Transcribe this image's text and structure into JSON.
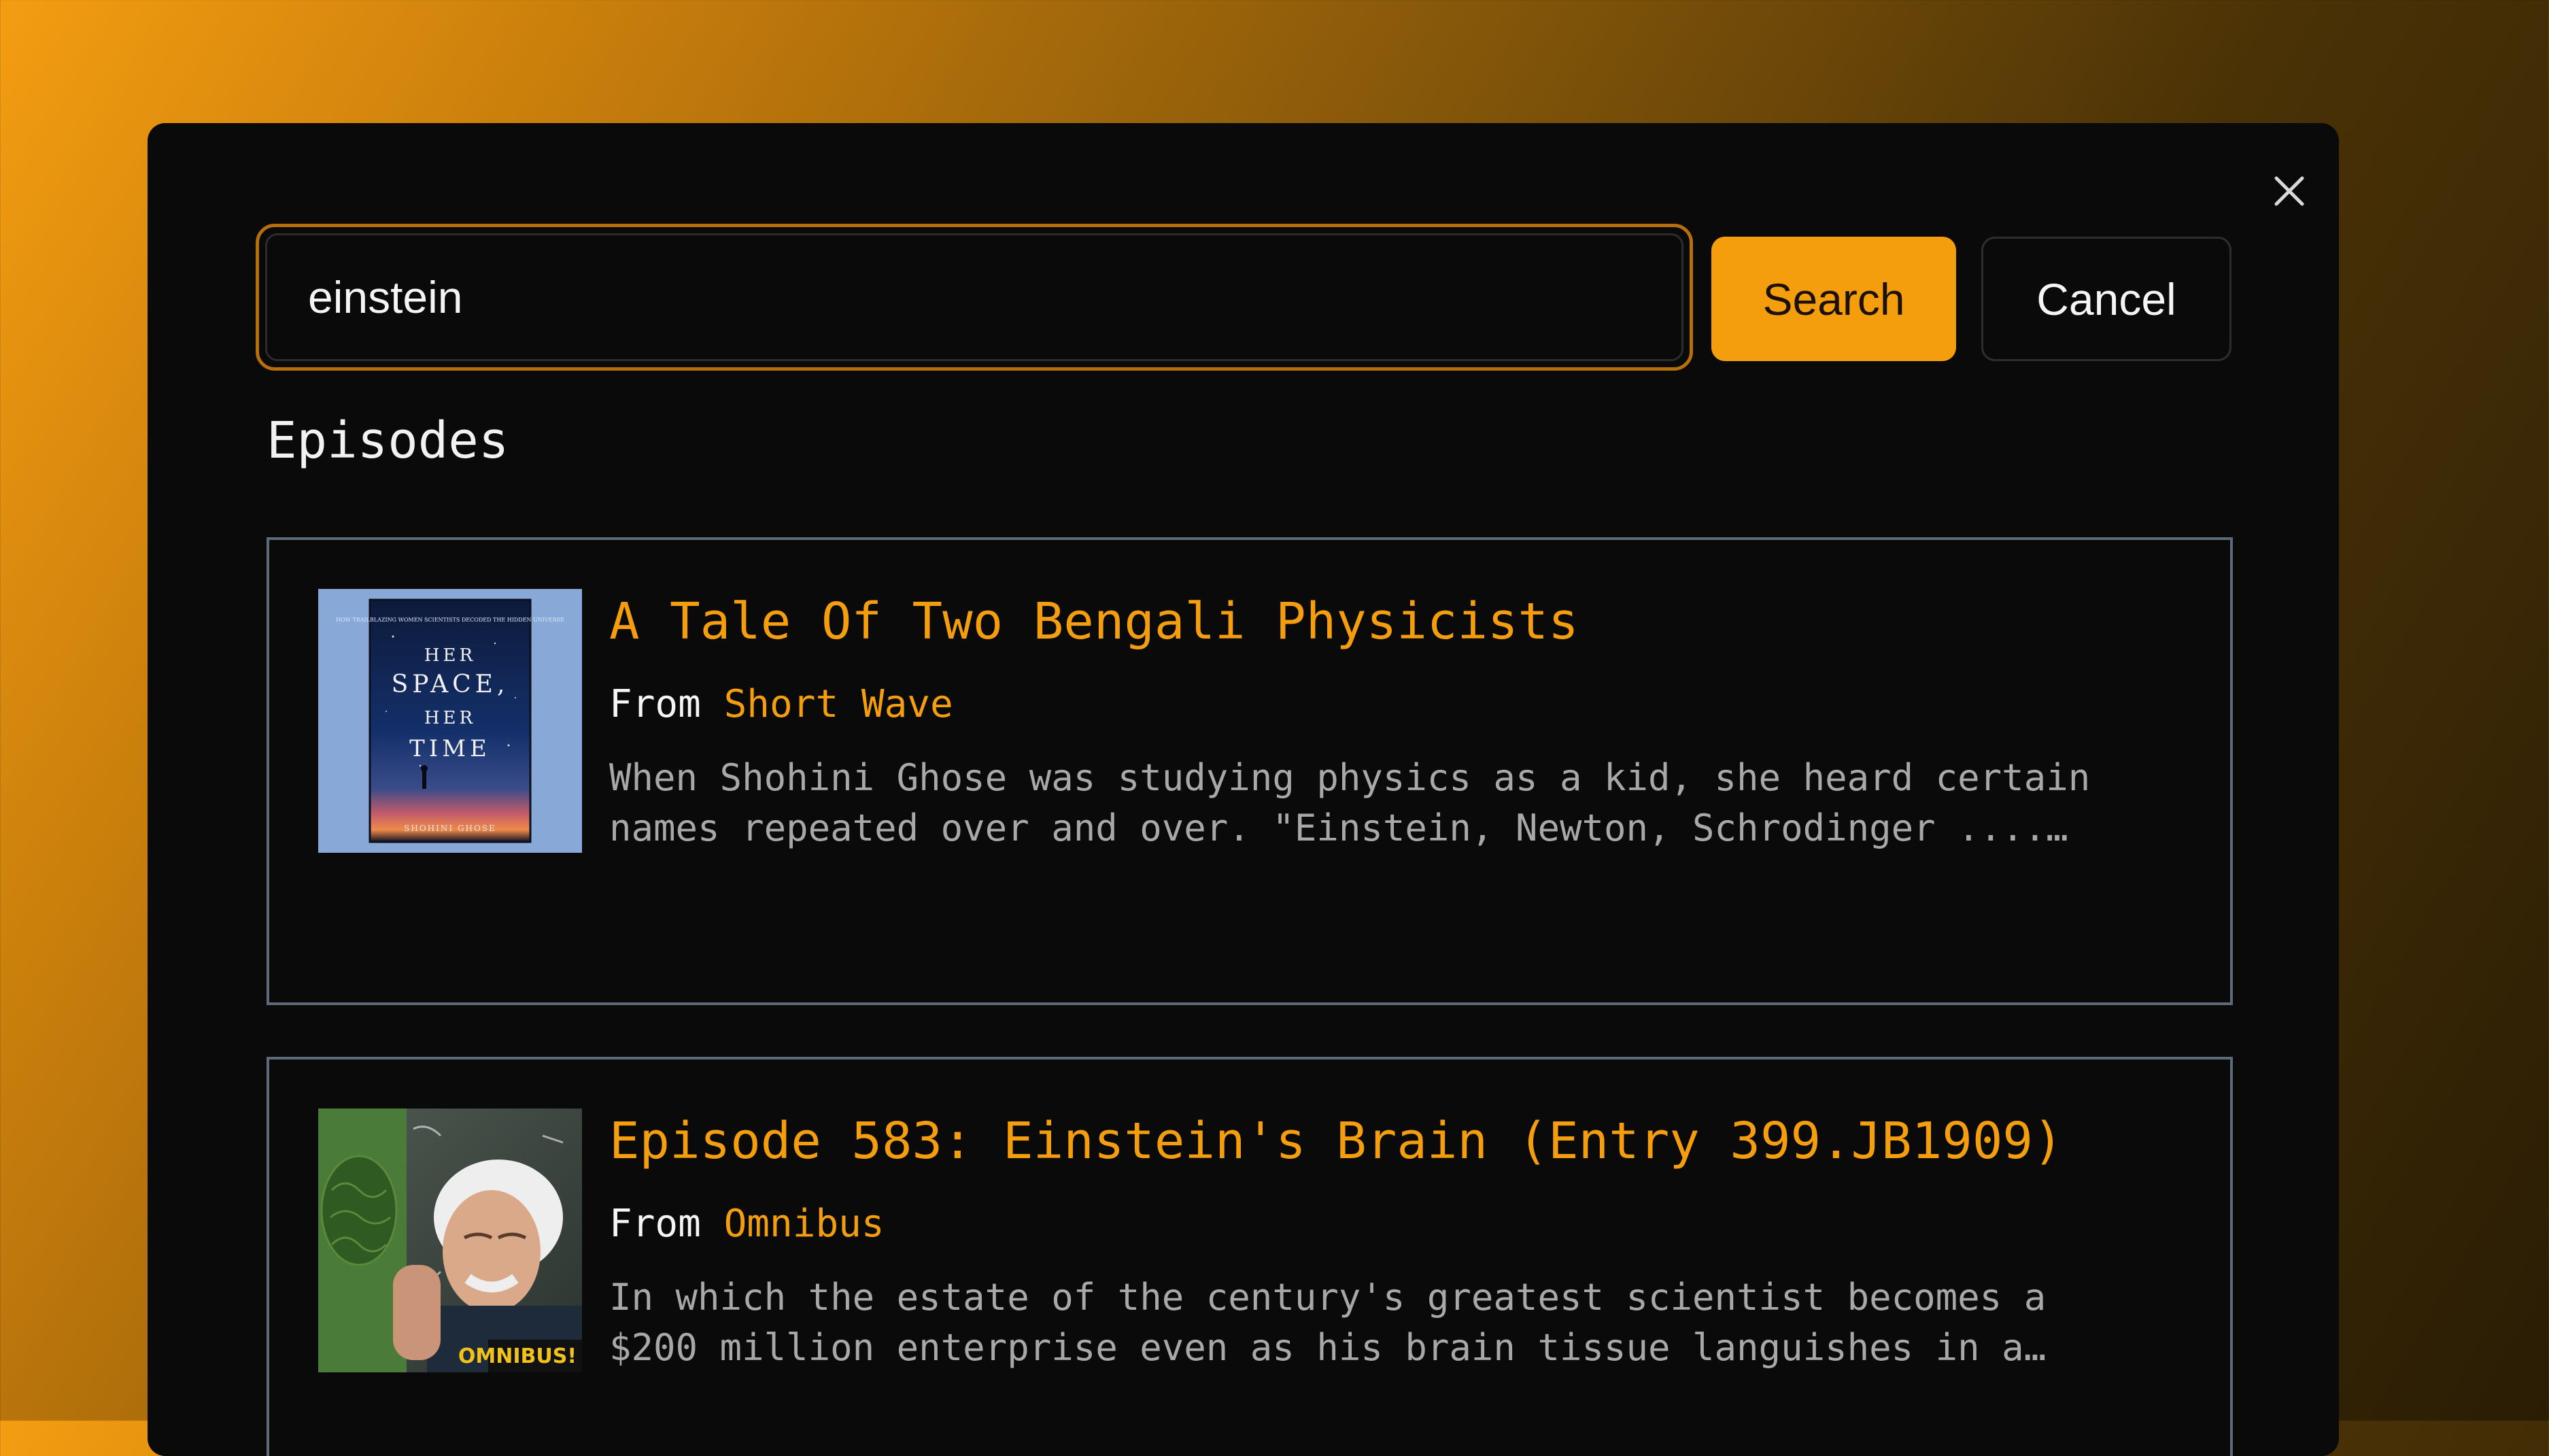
{
  "search": {
    "value": "einstein",
    "submit_label": "Search",
    "cancel_label": "Cancel"
  },
  "section_title": "Episodes",
  "episodes": [
    {
      "title": "A Tale Of Two Bengali Physicists",
      "from_label": "From",
      "podcast": "Short Wave",
      "description": "When Shohini Ghose was studying physics as a kid, she heard certain names repeated over and over. \"Einstein, Newton, Schrodinger ....…",
      "cover": {
        "tagline": "HOW TRAILBLAZING WOMEN SCIENTISTS DECODED THE HIDDEN UNIVERSE",
        "line1": "HER",
        "line2": "SPACE,",
        "line3": "HER",
        "line4": "TIME",
        "author": "SHOHINI GHOSE"
      }
    },
    {
      "title": "Episode 583: Einstein's Brain (Entry 399.JB1909)",
      "from_label": "From",
      "podcast": "Omnibus",
      "description": "In which the estate of the century's greatest scientist becomes a $200 million enterprise even as his brain tissue languishes in a…",
      "cover": {
        "brand": "OMNIBUS!"
      }
    }
  ],
  "icons": {
    "close": "close-icon"
  },
  "colors": {
    "accent": "#f49e0e",
    "background": "#0a0a0a",
    "card_border": "#5d6a7a",
    "muted_text": "#a8a8a8"
  }
}
